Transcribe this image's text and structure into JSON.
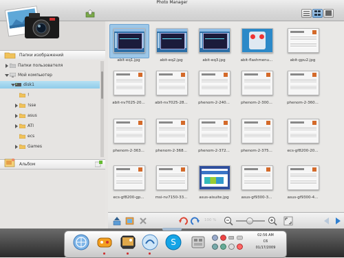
{
  "window": {
    "title": "Photo Manager"
  },
  "toolbar": {
    "view_buttons": [
      "list-view",
      "thumbnail-view",
      "large-thumbnail-view"
    ],
    "active_view": "thumbnail-view"
  },
  "sidebar": {
    "sections": {
      "image_folders": "Папки изображений",
      "user_folders": "Папки пользователя",
      "my_computer": "Мой компьютер",
      "album": "Альбом"
    },
    "tree": [
      {
        "label": "disk1",
        "level": 1,
        "selected": true,
        "expanded": true
      },
      {
        "label": "!",
        "level": 2
      },
      {
        "label": "!sse",
        "level": 2
      },
      {
        "label": "asus",
        "level": 2
      },
      {
        "label": "ATI",
        "level": 2
      },
      {
        "label": "ecs",
        "level": 2
      },
      {
        "label": "Games",
        "level": 2
      }
    ]
  },
  "thumbnails": [
    {
      "caption": "abit-eq1.jpg",
      "kind": "screen",
      "selected": true
    },
    {
      "caption": "abit-eq2.jpg",
      "kind": "screen"
    },
    {
      "caption": "abit-eq3.jpg",
      "kind": "screen"
    },
    {
      "caption": "abit-flashmenu...",
      "kind": "flash"
    },
    {
      "caption": "abit-gpu2.jpg",
      "kind": "doc"
    },
    {
      "caption": "abit-nv7025-20...",
      "kind": "doc"
    },
    {
      "caption": "abit-nv7025-28...",
      "kind": "doc"
    },
    {
      "caption": "phenom-2-240...",
      "kind": "doc"
    },
    {
      "caption": "phenom-2-300...",
      "kind": "doc"
    },
    {
      "caption": "phenom-2-360...",
      "kind": "doc"
    },
    {
      "caption": "phenom-2-363...",
      "kind": "doc"
    },
    {
      "caption": "phenom-2-368...",
      "kind": "doc"
    },
    {
      "caption": "phenom-2-372...",
      "kind": "doc"
    },
    {
      "caption": "phenom-2-375...",
      "kind": "doc"
    },
    {
      "caption": "ecs-gf8200-20...",
      "kind": "doc"
    },
    {
      "caption": "ecs-gf8200-gp...",
      "kind": "doc"
    },
    {
      "caption": "msi-nv7150-33...",
      "kind": "doc"
    },
    {
      "caption": "asus-aisuite.jpg",
      "kind": "asus"
    },
    {
      "caption": "asus-gf9300-3...",
      "kind": "doc"
    },
    {
      "caption": "asus-gf9300-4...",
      "kind": "doc"
    }
  ],
  "bottom_toolbar": {
    "zoom_label": "100 %",
    "zoom_level_fraction": 0.45
  },
  "clock": {
    "time": "02:56 AM",
    "day": "C6",
    "date": "01/17/2009"
  },
  "colors": {
    "selection": "#9cc7e8",
    "tree_selection": "#8fcbea",
    "accent": "#2c89c8"
  }
}
